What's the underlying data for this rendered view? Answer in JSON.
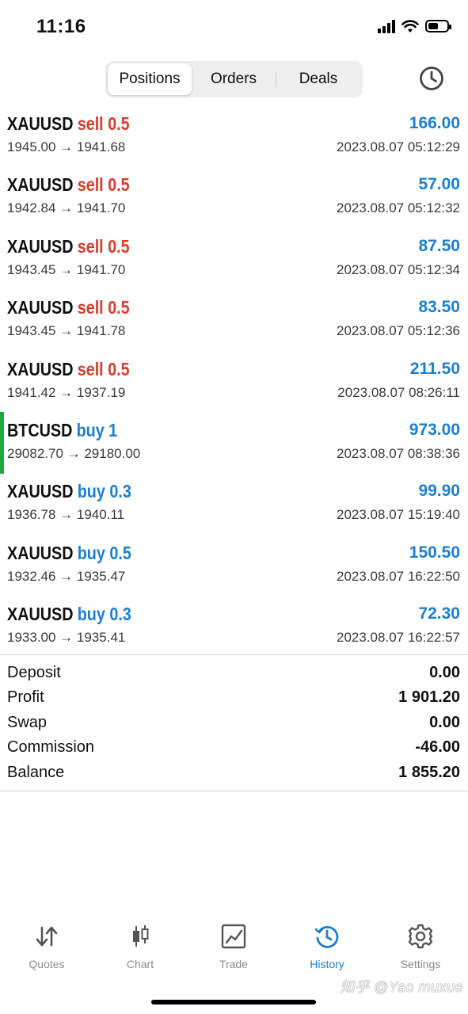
{
  "status_bar": {
    "time": "11:16",
    "battery_level": 0.55
  },
  "tabs": [
    {
      "label": "Positions",
      "active": true
    },
    {
      "label": "Orders",
      "active": false
    },
    {
      "label": "Deals",
      "active": false
    }
  ],
  "deals": [
    {
      "symbol": "XAUUSD",
      "side": "sell 0.5",
      "type": "sell",
      "open_close": "1945.00 → 1941.68",
      "datetime": "2023.08.07 05:12:29",
      "profit": "166.00"
    },
    {
      "symbol": "XAUUSD",
      "side": "sell 0.5",
      "type": "sell",
      "open_close": "1942.84 → 1941.70",
      "datetime": "2023.08.07 05:12:32",
      "profit": "57.00"
    },
    {
      "symbol": "XAUUSD",
      "side": "sell 0.5",
      "type": "sell",
      "open_close": "1943.45 → 1941.70",
      "datetime": "2023.08.07 05:12:34",
      "profit": "87.50"
    },
    {
      "symbol": "XAUUSD",
      "side": "sell 0.5",
      "type": "sell",
      "open_close": "1943.45 → 1941.78",
      "datetime": "2023.08.07 05:12:36",
      "profit": "83.50"
    },
    {
      "symbol": "XAUUSD",
      "side": "sell 0.5",
      "type": "sell",
      "open_close": "1941.42 → 1937.19",
      "datetime": "2023.08.07 08:26:11",
      "profit": "211.50"
    },
    {
      "symbol": "BTCUSD",
      "side": "buy 1",
      "type": "buy",
      "open_close": "29082.70 → 29180.00",
      "datetime": "2023.08.07 08:38:36",
      "profit": "973.00",
      "highlighted": true
    },
    {
      "symbol": "XAUUSD",
      "side": "buy 0.3",
      "type": "buy",
      "open_close": "1936.78 → 1940.11",
      "datetime": "2023.08.07 15:19:40",
      "profit": "99.90"
    },
    {
      "symbol": "XAUUSD",
      "side": "buy 0.5",
      "type": "buy",
      "open_close": "1932.46 → 1935.47",
      "datetime": "2023.08.07 16:22:50",
      "profit": "150.50"
    },
    {
      "symbol": "XAUUSD",
      "side": "buy 0.3",
      "type": "buy",
      "open_close": "1933.00 → 1935.41",
      "datetime": "2023.08.07 16:22:57",
      "profit": "72.30"
    }
  ],
  "summary": {
    "deposit_label": "Deposit",
    "deposit_value": "0.00",
    "profit_label": "Profit",
    "profit_value": "1 901.20",
    "swap_label": "Swap",
    "swap_value": "0.00",
    "commission_label": "Commission",
    "commission_value": "-46.00",
    "balance_label": "Balance",
    "balance_value": "1 855.20"
  },
  "nav": [
    {
      "label": "Quotes",
      "icon": "arrows-updown-icon"
    },
    {
      "label": "Chart",
      "icon": "candlestick-icon"
    },
    {
      "label": "Trade",
      "icon": "trend-chart-icon"
    },
    {
      "label": "History",
      "icon": "history-clock-icon",
      "active": true
    },
    {
      "label": "Settings",
      "icon": "gear-icon"
    }
  ],
  "colors": {
    "sell": "#d83c2c",
    "buy": "#1b7fd1",
    "highlight": "#1fa83a"
  },
  "watermark": "知乎 @Yao muxue"
}
